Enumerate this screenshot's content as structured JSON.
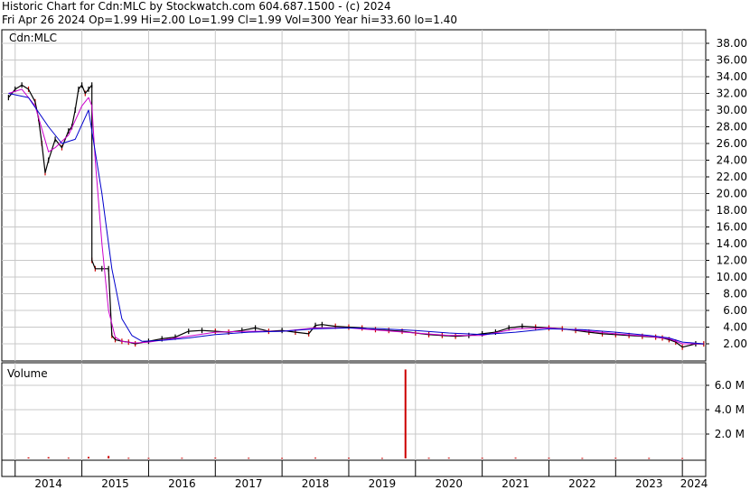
{
  "header": {
    "title": "Historic Chart for Cdn:MLC by Stockwatch.com 604.687.1500 - (c) 2024",
    "quote": "Fri Apr 26 2024   Op=1.99  Hi=2.00  Lo=1.99  Cl=1.99  Vol=300   Year hi=33.60  lo=1.40"
  },
  "chart_data": [
    {
      "type": "line",
      "title": "",
      "panel_label": "Cdn:MLC",
      "xlabel": "",
      "ylabel": "",
      "ylim": [
        0,
        39
      ],
      "y_ticks": [
        "38.00",
        "36.00",
        "34.00",
        "32.00",
        "30.00",
        "28.00",
        "26.00",
        "24.00",
        "22.00",
        "20.00",
        "18.00",
        "16.00",
        "14.00",
        "12.00",
        "10.00",
        "8.00",
        "6.00",
        "4.00",
        "2.00"
      ],
      "x_ticks": [
        "2014",
        "2015",
        "2016",
        "2017",
        "2018",
        "2019",
        "2020",
        "2021",
        "2022",
        "2023",
        "2024"
      ],
      "grid": true,
      "colors": {
        "price": "#000000",
        "down_bar": "#cc0000",
        "ma_short": "#cc00cc",
        "ma_long": "#0000cc",
        "volume": "#cc0000"
      },
      "series": [
        {
          "key": "price",
          "x": [
            2013.9,
            2014.0,
            2014.1,
            2014.2,
            2014.3,
            2014.35,
            2014.4,
            2014.45,
            2014.5,
            2014.6,
            2014.7,
            2014.8,
            2014.85,
            2014.9,
            2014.95,
            2015.0,
            2015.05,
            2015.1,
            2015.15,
            2015.15,
            2015.2,
            2015.3,
            2015.4,
            2015.45,
            2015.5,
            2015.6,
            2015.7,
            2015.8,
            2016.0,
            2016.2,
            2016.4,
            2016.6,
            2016.8,
            2017.0,
            2017.2,
            2017.4,
            2017.6,
            2017.8,
            2018.0,
            2018.2,
            2018.4,
            2018.5,
            2018.6,
            2018.8,
            2019.0,
            2019.2,
            2019.4,
            2019.6,
            2019.8,
            2020.0,
            2020.2,
            2020.4,
            2020.6,
            2020.8,
            2021.0,
            2021.2,
            2021.4,
            2021.6,
            2021.8,
            2022.0,
            2022.2,
            2022.4,
            2022.6,
            2022.8,
            2023.0,
            2023.2,
            2023.4,
            2023.6,
            2023.7,
            2023.8,
            2023.9,
            2024.0,
            2024.2,
            2024.32
          ],
          "y": [
            31.5,
            32.5,
            33.0,
            32.5,
            31.0,
            29.0,
            26.0,
            22.5,
            24.0,
            26.5,
            25.5,
            27.5,
            28.0,
            30.0,
            32.5,
            33.0,
            32.0,
            32.5,
            33.0,
            12.0,
            11.0,
            11.0,
            11.0,
            3.0,
            2.5,
            2.3,
            2.2,
            2.0,
            2.3,
            2.6,
            2.8,
            3.5,
            3.6,
            3.5,
            3.4,
            3.6,
            3.9,
            3.5,
            3.6,
            3.4,
            3.2,
            4.2,
            4.3,
            4.1,
            4.0,
            3.9,
            3.7,
            3.6,
            3.5,
            3.3,
            3.1,
            3.0,
            2.9,
            3.0,
            3.2,
            3.4,
            3.9,
            4.1,
            4.0,
            3.9,
            3.8,
            3.6,
            3.4,
            3.2,
            3.1,
            3.0,
            2.9,
            2.8,
            2.7,
            2.5,
            2.2,
            1.6,
            2.0,
            1.99
          ]
        },
        {
          "key": "ma_short",
          "x": [
            2013.9,
            2014.1,
            2014.3,
            2014.5,
            2014.6,
            2014.8,
            2015.0,
            2015.1,
            2015.15,
            2015.2,
            2015.3,
            2015.4,
            2015.5,
            2015.6,
            2015.8,
            2016.0,
            2016.5,
            2017.0,
            2017.5,
            2018.0,
            2018.5,
            2019.0,
            2019.5,
            2020.0,
            2020.5,
            2021.0,
            2021.5,
            2022.0,
            2022.5,
            2023.0,
            2023.5,
            2023.8,
            2024.0,
            2024.32
          ],
          "y": [
            32.0,
            32.5,
            30.5,
            25.0,
            25.5,
            27.0,
            30.5,
            31.5,
            30.5,
            24.0,
            14.0,
            6.0,
            2.8,
            2.3,
            2.1,
            2.2,
            2.8,
            3.4,
            3.5,
            3.5,
            3.9,
            3.9,
            3.6,
            3.3,
            3.0,
            3.0,
            3.8,
            3.9,
            3.6,
            3.2,
            2.9,
            2.6,
            2.0,
            2.0
          ]
        },
        {
          "key": "ma_long",
          "x": [
            2013.9,
            2014.2,
            2014.5,
            2014.7,
            2014.9,
            2015.1,
            2015.2,
            2015.3,
            2015.45,
            2015.6,
            2015.75,
            2015.9,
            2016.2,
            2016.6,
            2017.0,
            2017.5,
            2018.0,
            2018.5,
            2019.0,
            2019.5,
            2020.0,
            2020.5,
            2021.0,
            2021.5,
            2022.0,
            2022.5,
            2023.0,
            2023.5,
            2023.8,
            2024.0,
            2024.32
          ],
          "y": [
            32.0,
            31.5,
            28.0,
            26.0,
            26.5,
            30.0,
            25.0,
            20.0,
            11.0,
            5.0,
            3.0,
            2.3,
            2.4,
            2.7,
            3.1,
            3.4,
            3.5,
            3.8,
            3.9,
            3.8,
            3.6,
            3.3,
            3.1,
            3.4,
            3.8,
            3.7,
            3.4,
            3.0,
            2.7,
            2.2,
            2.0
          ]
        }
      ]
    },
    {
      "type": "bar",
      "title": "",
      "panel_label": "Volume",
      "ylabel": "",
      "ylim": [
        0,
        7.6
      ],
      "y_ticks": [
        "6.0 M",
        "4.0 M",
        "2.0 M"
      ],
      "series": [
        {
          "name": "Volume",
          "x": [
            2014.2,
            2014.5,
            2014.8,
            2015.1,
            2015.4,
            2015.7,
            2016.0,
            2016.5,
            2017.0,
            2017.5,
            2018.0,
            2018.5,
            2019.0,
            2019.5,
            2019.85,
            2020.2,
            2020.5,
            2021.0,
            2021.5,
            2022.0,
            2022.5,
            2023.0,
            2023.5,
            2024.0
          ],
          "values": [
            0.08,
            0.1,
            0.06,
            0.12,
            0.2,
            0.05,
            0.04,
            0.05,
            0.06,
            0.05,
            0.04,
            0.06,
            0.05,
            0.04,
            7.3,
            0.05,
            0.06,
            0.05,
            0.06,
            0.05,
            0.04,
            0.05,
            0.04,
            0.03
          ]
        }
      ]
    }
  ]
}
